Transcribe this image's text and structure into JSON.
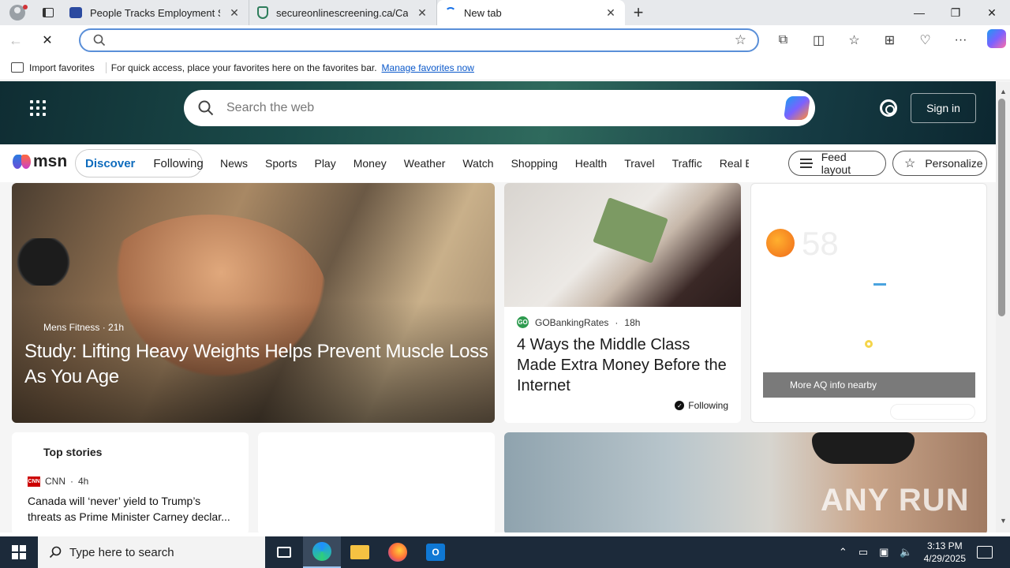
{
  "tabs": [
    {
      "title": "People Tracks Employment Scree",
      "close": "✕"
    },
    {
      "title": "secureonlinescreening.ca/Candid",
      "close": "✕"
    },
    {
      "title": "New tab",
      "close": "✕"
    }
  ],
  "window": {
    "minimize": "—",
    "restore": "❐",
    "close": "✕",
    "newtab": "+"
  },
  "address": {
    "value": "",
    "placeholder": ""
  },
  "favorites_bar": {
    "import": "Import favorites",
    "hint": "For quick access, place your favorites here on the favorites bar.",
    "link": "Manage favorites now"
  },
  "msn": {
    "search_placeholder": "Search the web",
    "signin": "Sign in",
    "logo": "msn",
    "discover": "Discover",
    "following": "Following",
    "categories": [
      "News",
      "Sports",
      "Play",
      "Money",
      "Weather",
      "Watch",
      "Shopping",
      "Health",
      "Travel",
      "Traffic",
      "Real E"
    ],
    "feed_layout": "Feed layout",
    "personalize": "Personalize"
  },
  "hero_card": {
    "source": "Mens Fitness",
    "age": "21h",
    "title": "Study: Lifting Heavy Weights Helps Prevent Muscle Loss As You Age"
  },
  "money_card": {
    "source": "GOBankingRates",
    "age": "18h",
    "title": "4 Ways the Middle Class Made Extra Money Before the Internet",
    "following": "Following"
  },
  "weather_card": {
    "temp": "58",
    "aq_button": "More AQ info nearby"
  },
  "top_stories": {
    "heading": "Top stories",
    "source": "CNN",
    "age": "4h",
    "title": "Canada will ‘never’ yield to Trump’s threats as Prime Minister Carney declar..."
  },
  "watermark": "ANY RUN",
  "taskbar": {
    "search_placeholder": "Type here to search",
    "time": "3:13 PM",
    "date": "4/29/2025"
  },
  "icons": [
    "profile-icon",
    "tab-actions-icon",
    "back-icon",
    "refresh-icon",
    "search-icon",
    "favorite-star-icon",
    "extensions-icon",
    "split-screen-icon",
    "favorites-icon",
    "collections-icon",
    "browser-essentials-icon",
    "more-icon",
    "copilot-icon",
    "apps-grid-icon",
    "settings-gear-icon",
    "windows-start-icon",
    "task-view-icon"
  ]
}
